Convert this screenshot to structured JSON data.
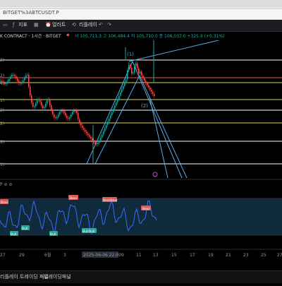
{
  "browser": {
    "url": "BITGET%3ABTCUSDT.P"
  },
  "toolbar": {
    "items": [
      {
        "label": "지표"
      },
      {
        "label": "얼러트"
      },
      {
        "label": "리플레이"
      }
    ]
  },
  "infobar": {
    "symbol": "K CONTRACT · 1시간 · BITGET",
    "ohlc": "시 105,711.3  고 106,484.4  저 105,710.0  종 106,037.0  +325.9 (+0.31%)"
  },
  "chart": {
    "y_labels": [
      "2)",
      "2)",
      "4)",
      "1)",
      "2)",
      "2)",
      "9)",
      "1)"
    ],
    "wave_labels": {
      "w1": "(1)",
      "w2": "(2)"
    },
    "osc_header": "P ⊘ ⊘",
    "osc_badges": {
      "bear": "Bear",
      "bull": "Bull",
      "hidden_bear": "Bearbear"
    },
    "x_axis": [
      "27",
      "29",
      "6월",
      "3",
      "2025-06-06 22:00",
      "9",
      "11",
      "13",
      "15",
      "17",
      "19",
      "21",
      "23",
      "25",
      "27"
    ],
    "colors": {
      "up": "#26a69a",
      "down": "#ef5350",
      "white_line": "#ffffff",
      "yellow_line": "#e6d84a",
      "red_line": "#e05a5a",
      "channel": "#5aa9e6",
      "osc_bg": "#0f2a3a",
      "osc_line": "#3b6bff"
    }
  },
  "status": {
    "items": [
      {
        "label": "리플레이 트레이딩 패널"
      },
      {
        "label": "트레이딩패널"
      }
    ]
  }
}
